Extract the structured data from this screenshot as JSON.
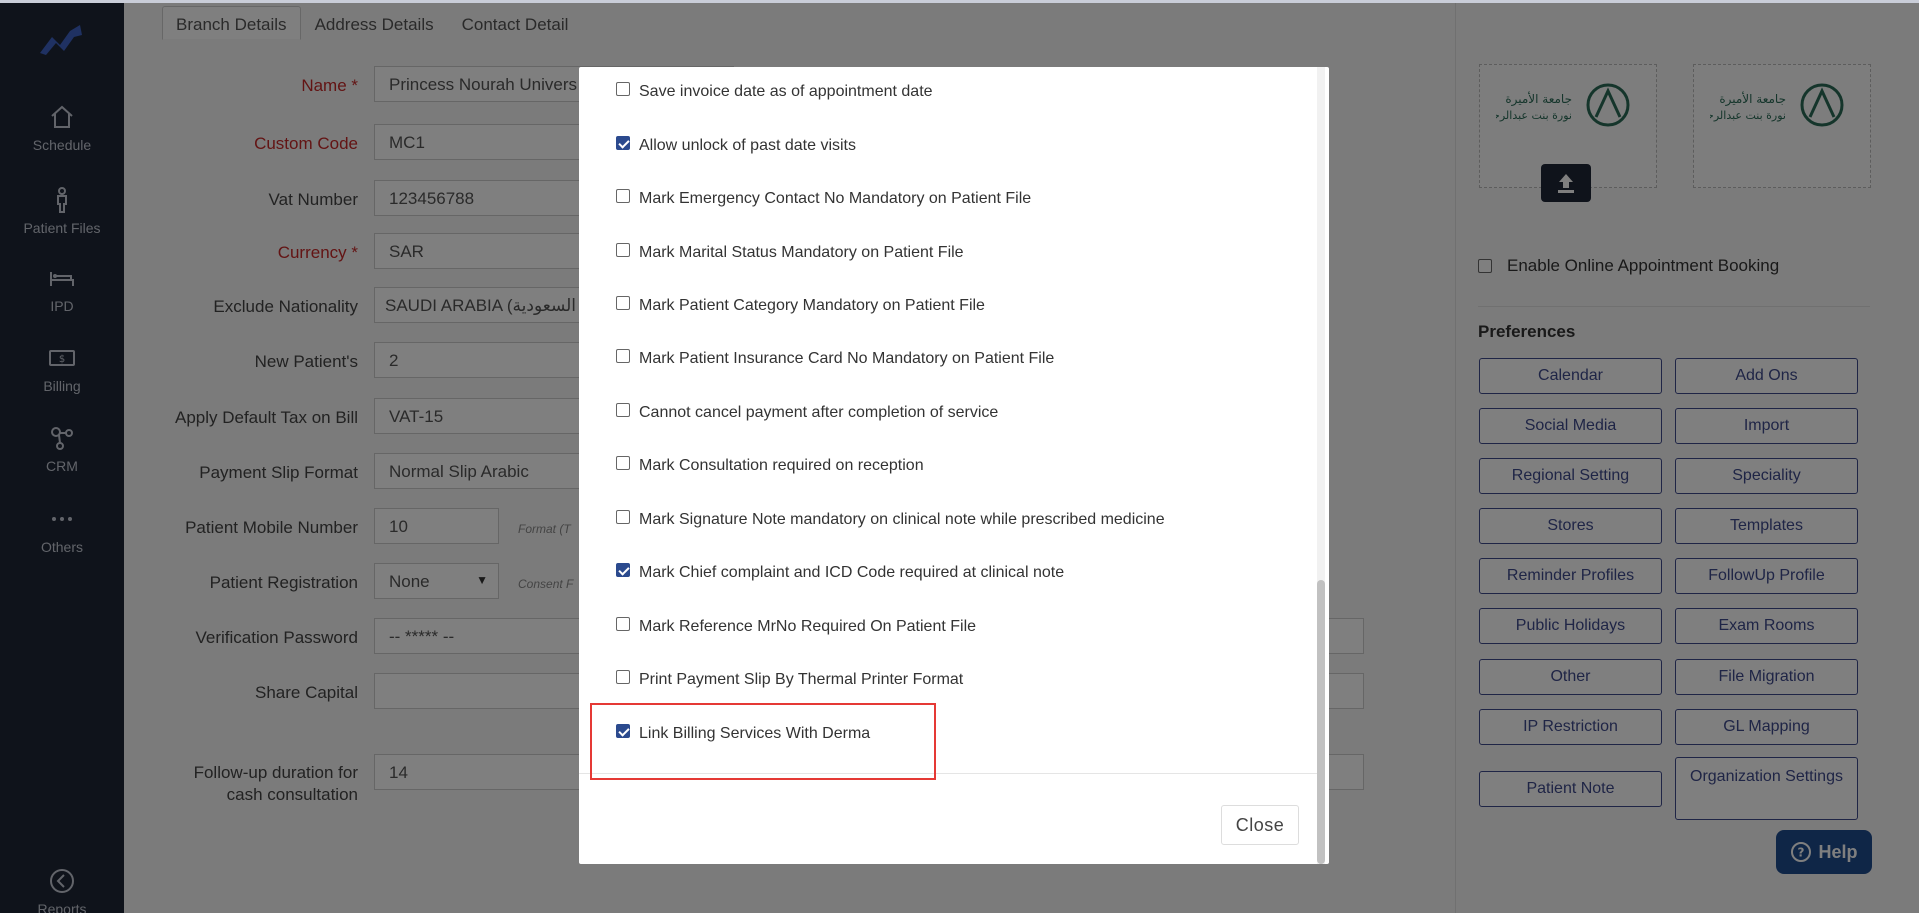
{
  "sidebar": {
    "items": [
      {
        "label": "Schedule",
        "icon": "home-icon"
      },
      {
        "label": "Patient Files",
        "icon": "person-icon"
      },
      {
        "label": "IPD",
        "icon": "bed-icon"
      },
      {
        "label": "Billing",
        "icon": "money-icon"
      },
      {
        "label": "CRM",
        "icon": "network-icon"
      },
      {
        "label": "Others",
        "icon": "more-dots-icon"
      },
      {
        "label": "Reports",
        "icon": "back-arrow-icon"
      }
    ]
  },
  "tabs": [
    {
      "label": "Branch Details",
      "active": true
    },
    {
      "label": "Address Details",
      "active": false
    },
    {
      "label": "Contact Detail",
      "active": false
    }
  ],
  "form": {
    "name_label": "Name *",
    "name_value": "Princess Nourah Univers",
    "custom_code_label": "Custom Code",
    "custom_code_value": "MC1",
    "vat_label": "Vat Number",
    "vat_value": "123456788",
    "currency_label": "Currency *",
    "currency_value": "SAR",
    "exclude_nat_label": "Exclude Nationality",
    "exclude_nat_value": "SAUDI ARABIA (السعودية",
    "new_patient_label": "New Patient's",
    "new_patient_value": "2",
    "apply_tax_label": "Apply Default Tax on Bill",
    "apply_tax_value": "VAT-15",
    "payment_slip_label": "Payment Slip Format",
    "payment_slip_value": "Normal Slip Arabic",
    "mobile_label": "Patient Mobile Number",
    "mobile_value": "10",
    "mobile_hint": "Format (T",
    "registration_label": "Patient Registration",
    "registration_value": "None",
    "registration_hint": "Consent F",
    "verification_label": "Verification Password",
    "verification_value": "-- ***** --",
    "share_capital_label": "Share Capital",
    "followup_label_1": "Follow-up duration for",
    "followup_label_2": "cash consultation",
    "followup_value": "14"
  },
  "right_panel": {
    "enable_booking_label": "Enable Online Appointment Booking",
    "preferences_title": "Preferences",
    "buttons": [
      "Calendar",
      "Add Ons",
      "Social Media",
      "Import",
      "Regional Setting",
      "Speciality",
      "Stores",
      "Templates",
      "Reminder Profiles",
      "FollowUp Profile",
      "Public Holidays",
      "Exam Rooms",
      "Other",
      "File Migration",
      "IP Restriction",
      "GL Mapping",
      "Patient Note",
      "Organization Settings"
    ],
    "uni_logo_text_1": "جامعة الأميرة",
    "uni_logo_text_2": "نورة بنت عبدالرحمن"
  },
  "help_label": "Help",
  "modal": {
    "options": [
      {
        "label": "Save invoice date as of appointment date",
        "checked": false
      },
      {
        "label": "Allow unlock of past date visits",
        "checked": true
      },
      {
        "label": "Mark Emergency Contact No Mandatory on Patient File",
        "checked": false
      },
      {
        "label": "Mark Marital Status Mandatory on Patient File",
        "checked": false
      },
      {
        "label": "Mark Patient Category Mandatory on Patient File",
        "checked": false
      },
      {
        "label": "Mark Patient Insurance Card No Mandatory on Patient File",
        "checked": false
      },
      {
        "label": "Cannot cancel payment after completion of service",
        "checked": false
      },
      {
        "label": "Mark Consultation required on reception",
        "checked": false
      },
      {
        "label": "Mark Signature Note mandatory on clinical note while prescribed medicine",
        "checked": false
      },
      {
        "label": "Mark Chief complaint and ICD Code required at clinical note",
        "checked": true
      },
      {
        "label": "Mark Reference MrNo Required On Patient File",
        "checked": false
      },
      {
        "label": "Print Payment Slip By Thermal Printer Format",
        "checked": false
      },
      {
        "label": "Link Billing Services With Derma",
        "checked": true
      }
    ],
    "close_label": "Close"
  },
  "colors": {
    "sidebar_bg": "#1e2636",
    "accent": "#3f4a8c",
    "checkbox_checked": "#2b4a8e",
    "required_label": "#c62828",
    "highlight_box": "#e53935",
    "help_bg": "#1f4c8f"
  }
}
